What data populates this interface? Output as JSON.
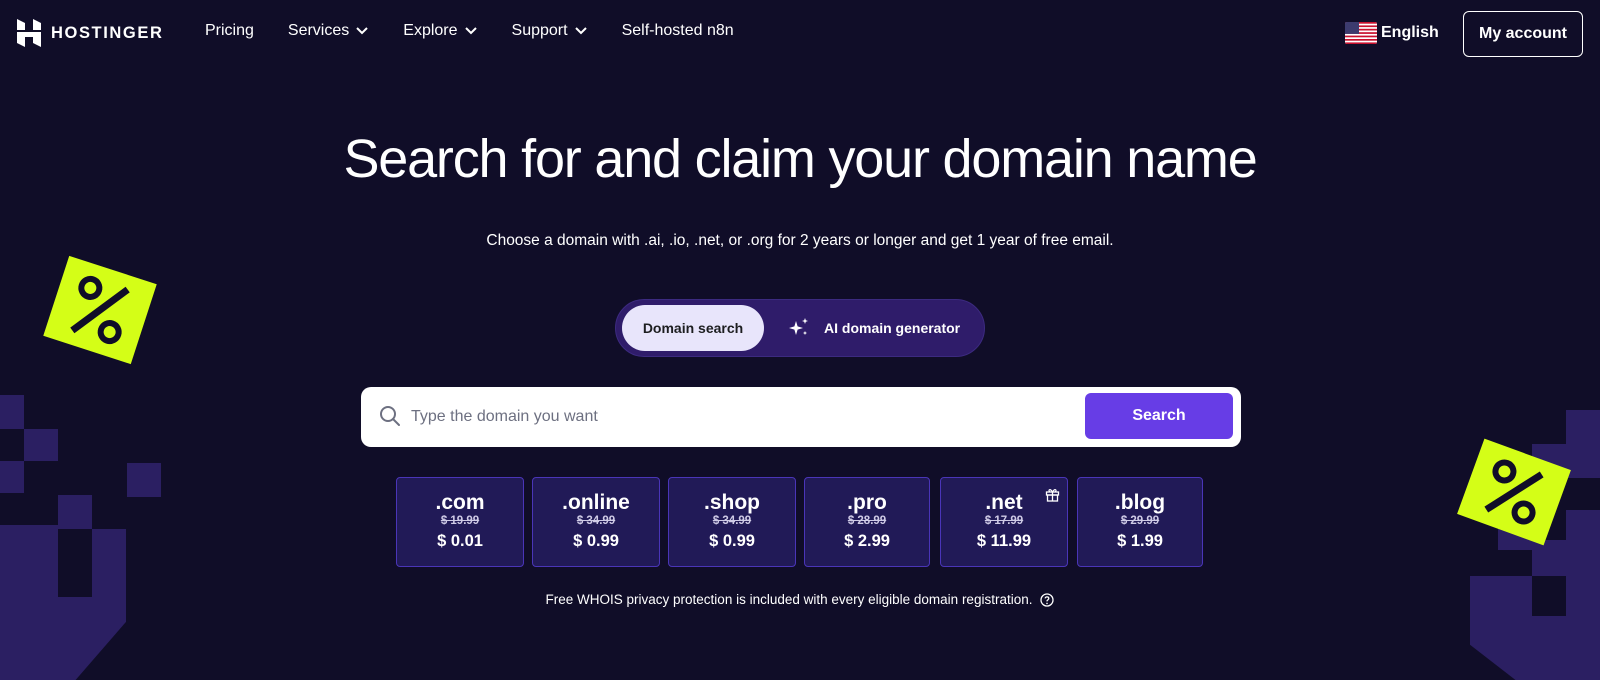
{
  "brand": {
    "name": "HOSTINGER"
  },
  "nav": {
    "links": [
      {
        "label": "Pricing",
        "dropdown": false
      },
      {
        "label": "Services",
        "dropdown": true
      },
      {
        "label": "Explore",
        "dropdown": true
      },
      {
        "label": "Support",
        "dropdown": true
      },
      {
        "label": "Self-hosted n8n",
        "dropdown": false
      }
    ],
    "language": "English",
    "account_label": "My account"
  },
  "hero": {
    "title": "Search for and claim your domain name",
    "subtitle": "Choose a domain with .ai, .io, .net, or .org for 2 years or longer and get 1 year of free email."
  },
  "toggle": {
    "active": "Domain search",
    "alternate": "AI domain generator"
  },
  "search": {
    "placeholder": "Type the domain you want",
    "value": "",
    "button_label": "Search"
  },
  "tlds": [
    {
      "name": ".com",
      "old_price": "$ 19.99",
      "price": "$ 0.01",
      "gift": false
    },
    {
      "name": ".online",
      "old_price": "$ 34.99",
      "price": "$ 0.99",
      "gift": false
    },
    {
      "name": ".shop",
      "old_price": "$ 34.99",
      "price": "$ 0.99",
      "gift": false
    },
    {
      "name": ".pro",
      "old_price": "$ 28.99",
      "price": "$ 2.99",
      "gift": false
    },
    {
      "name": ".net",
      "old_price": "$ 17.99",
      "price": "$ 11.99",
      "gift": true
    },
    {
      "name": ".blog",
      "old_price": "$ 29.99",
      "price": "$ 1.99",
      "gift": false
    }
  ],
  "footnote": "Free WHOIS privacy protection is included with every eligible domain registration.",
  "colors": {
    "background": "#100d28",
    "accent": "#673de6",
    "tag": "#d4fe17",
    "card": "#211a57"
  }
}
